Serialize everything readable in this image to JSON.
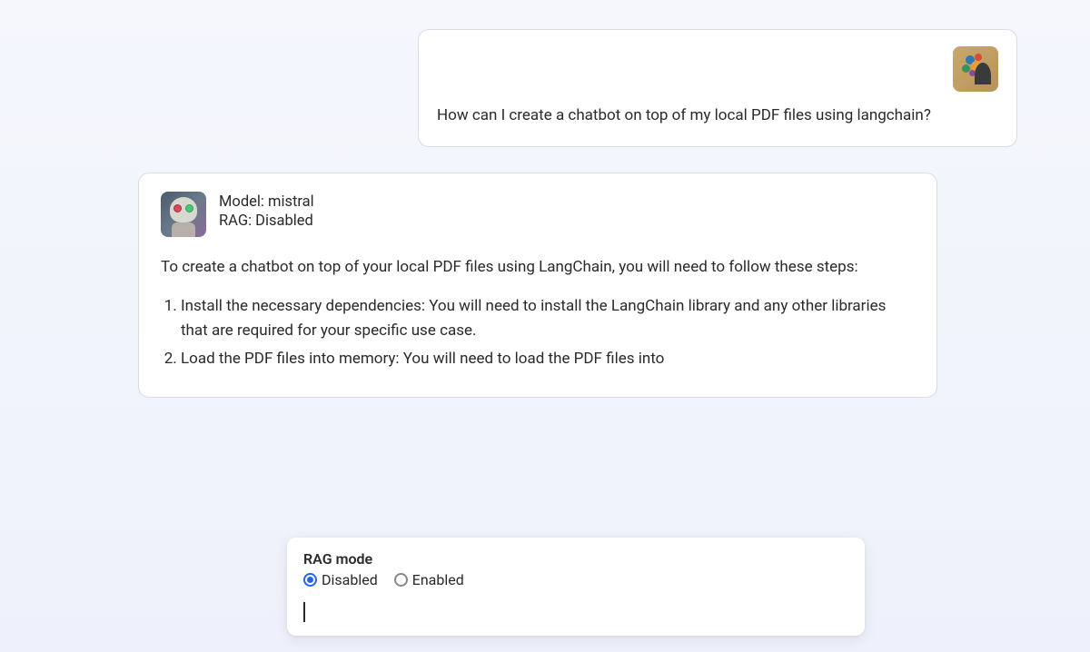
{
  "user_message": {
    "text": "How can I create a chatbot on top of my local PDF files using langchain?"
  },
  "assistant_message": {
    "model_label": "Model: mistral",
    "rag_label": "RAG: Disabled",
    "intro": "To create a chatbot on top of your local PDF files using LangChain, you will need to follow these steps:",
    "steps": [
      "Install the necessary dependencies: You will need to install the LangChain library and any other libraries that are required for your specific use case.",
      "Load the PDF files into memory: You will need to load the PDF files into"
    ]
  },
  "input_panel": {
    "rag_mode_label": "RAG mode",
    "options": {
      "disabled": "Disabled",
      "enabled": "Enabled"
    },
    "selected": "disabled",
    "input_value": ""
  }
}
